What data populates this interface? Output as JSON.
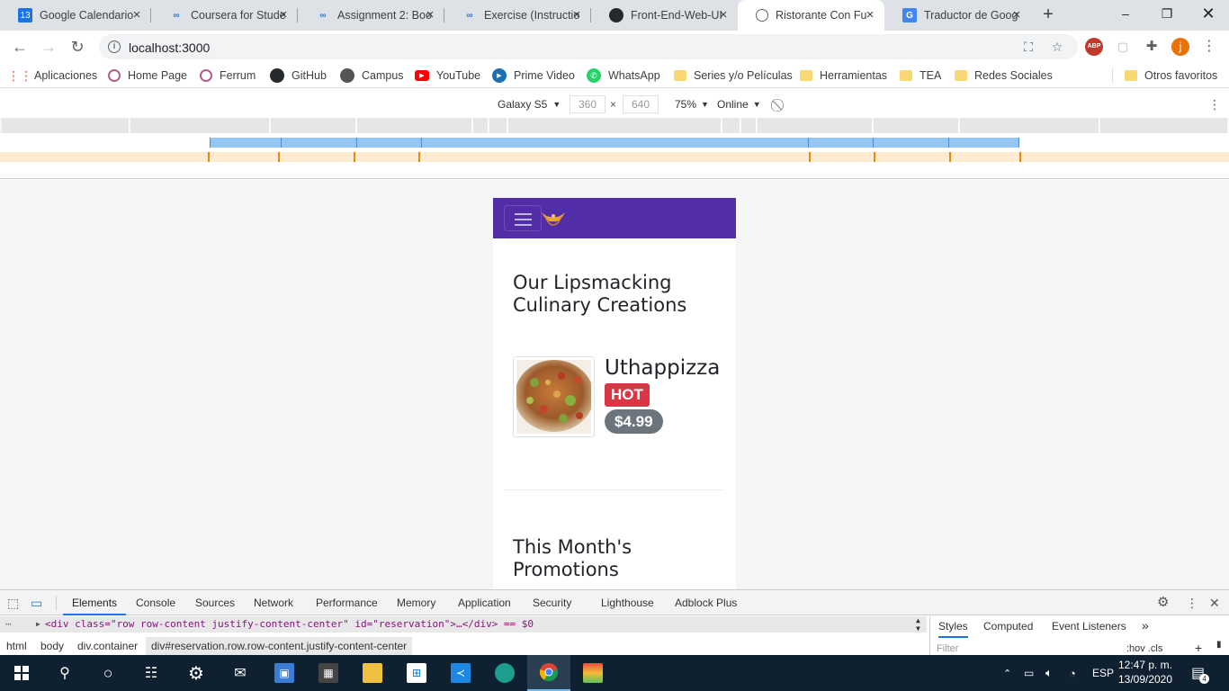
{
  "browser": {
    "tabs": [
      {
        "label": "Google Calendario",
        "icon": "calendar-icon",
        "badge": "13",
        "color": "#1a73e8"
      },
      {
        "label": "Coursera for Stude",
        "icon": "coursera-icon",
        "badge": "co",
        "color": "#2a73cc"
      },
      {
        "label": "Assignment 2: Boo",
        "icon": "coursera-icon",
        "badge": "co",
        "color": "#2a73cc"
      },
      {
        "label": "Exercise (Instructio",
        "icon": "coursera-icon",
        "badge": "co",
        "color": "#2a73cc"
      },
      {
        "label": "Front-End-Web-UI",
        "icon": "github-icon",
        "badge": "",
        "color": "#24292e"
      },
      {
        "label": "Ristorante Con Fu",
        "icon": "globe-icon",
        "badge": "",
        "color": "#5f6368"
      },
      {
        "label": "Traductor de Goog",
        "icon": "translate-icon",
        "badge": "G",
        "color": "#4285f4"
      }
    ],
    "url": "localhost:3000",
    "profile_initial": "j",
    "abp_label": "ABP"
  },
  "bookmarks": [
    {
      "label": "Aplicaciones",
      "icon": "apps-grid-icon"
    },
    {
      "label": "Home Page",
      "icon": "ferrum-icon"
    },
    {
      "label": "Ferrum",
      "icon": "ferrum-icon"
    },
    {
      "label": "GitHub",
      "icon": "github-icon"
    },
    {
      "label": "Campus",
      "icon": "globe-icon"
    },
    {
      "label": "YouTube",
      "icon": "youtube-icon"
    },
    {
      "label": "Prime Video",
      "icon": "prime-video-icon"
    },
    {
      "label": "WhatsApp",
      "icon": "whatsapp-icon"
    },
    {
      "label": "Series y/o Películas",
      "icon": "folder-icon"
    },
    {
      "label": "Herramientas",
      "icon": "folder-icon"
    },
    {
      "label": "TEA",
      "icon": "folder-icon"
    },
    {
      "label": "Redes Sociales",
      "icon": "folder-icon"
    },
    {
      "label": "Otros favoritos",
      "icon": "folder-icon"
    }
  ],
  "device_toolbar": {
    "device": "Galaxy S5",
    "width": "360",
    "height": "640",
    "times": "×",
    "zoom": "75%",
    "network": "Online"
  },
  "page": {
    "heading_creations": "Our Lipsmacking Culinary Creations",
    "dish_name": "Uthappizza",
    "dish_badge": "HOT",
    "dish_price": "$4.99",
    "heading_promotions": "This Month's Promotions",
    "colors": {
      "navbar": "#512da8",
      "hot": "#dc3545",
      "price": "#6c757d"
    }
  },
  "devtools": {
    "tabs": [
      "Elements",
      "Console",
      "Sources",
      "Network",
      "Performance",
      "Memory",
      "Application",
      "Security",
      "Lighthouse",
      "Adblock Plus"
    ],
    "selected_line": "<div class=\"row row-content justify-content-center\" id=\"reservation\">…</div> == $0",
    "breadcrumbs": [
      "html",
      "body",
      "div.container",
      "div#reservation.row.row-content.justify-content-center"
    ],
    "style_tabs": [
      "Styles",
      "Computed",
      "Event Listeners"
    ],
    "filter_placeholder": "Filter",
    "filter_tools": ":hov .cls"
  },
  "taskbar": {
    "language": "ESP",
    "time": "12:47 p. m.",
    "date": "13/09/2020",
    "notifications": "4"
  }
}
